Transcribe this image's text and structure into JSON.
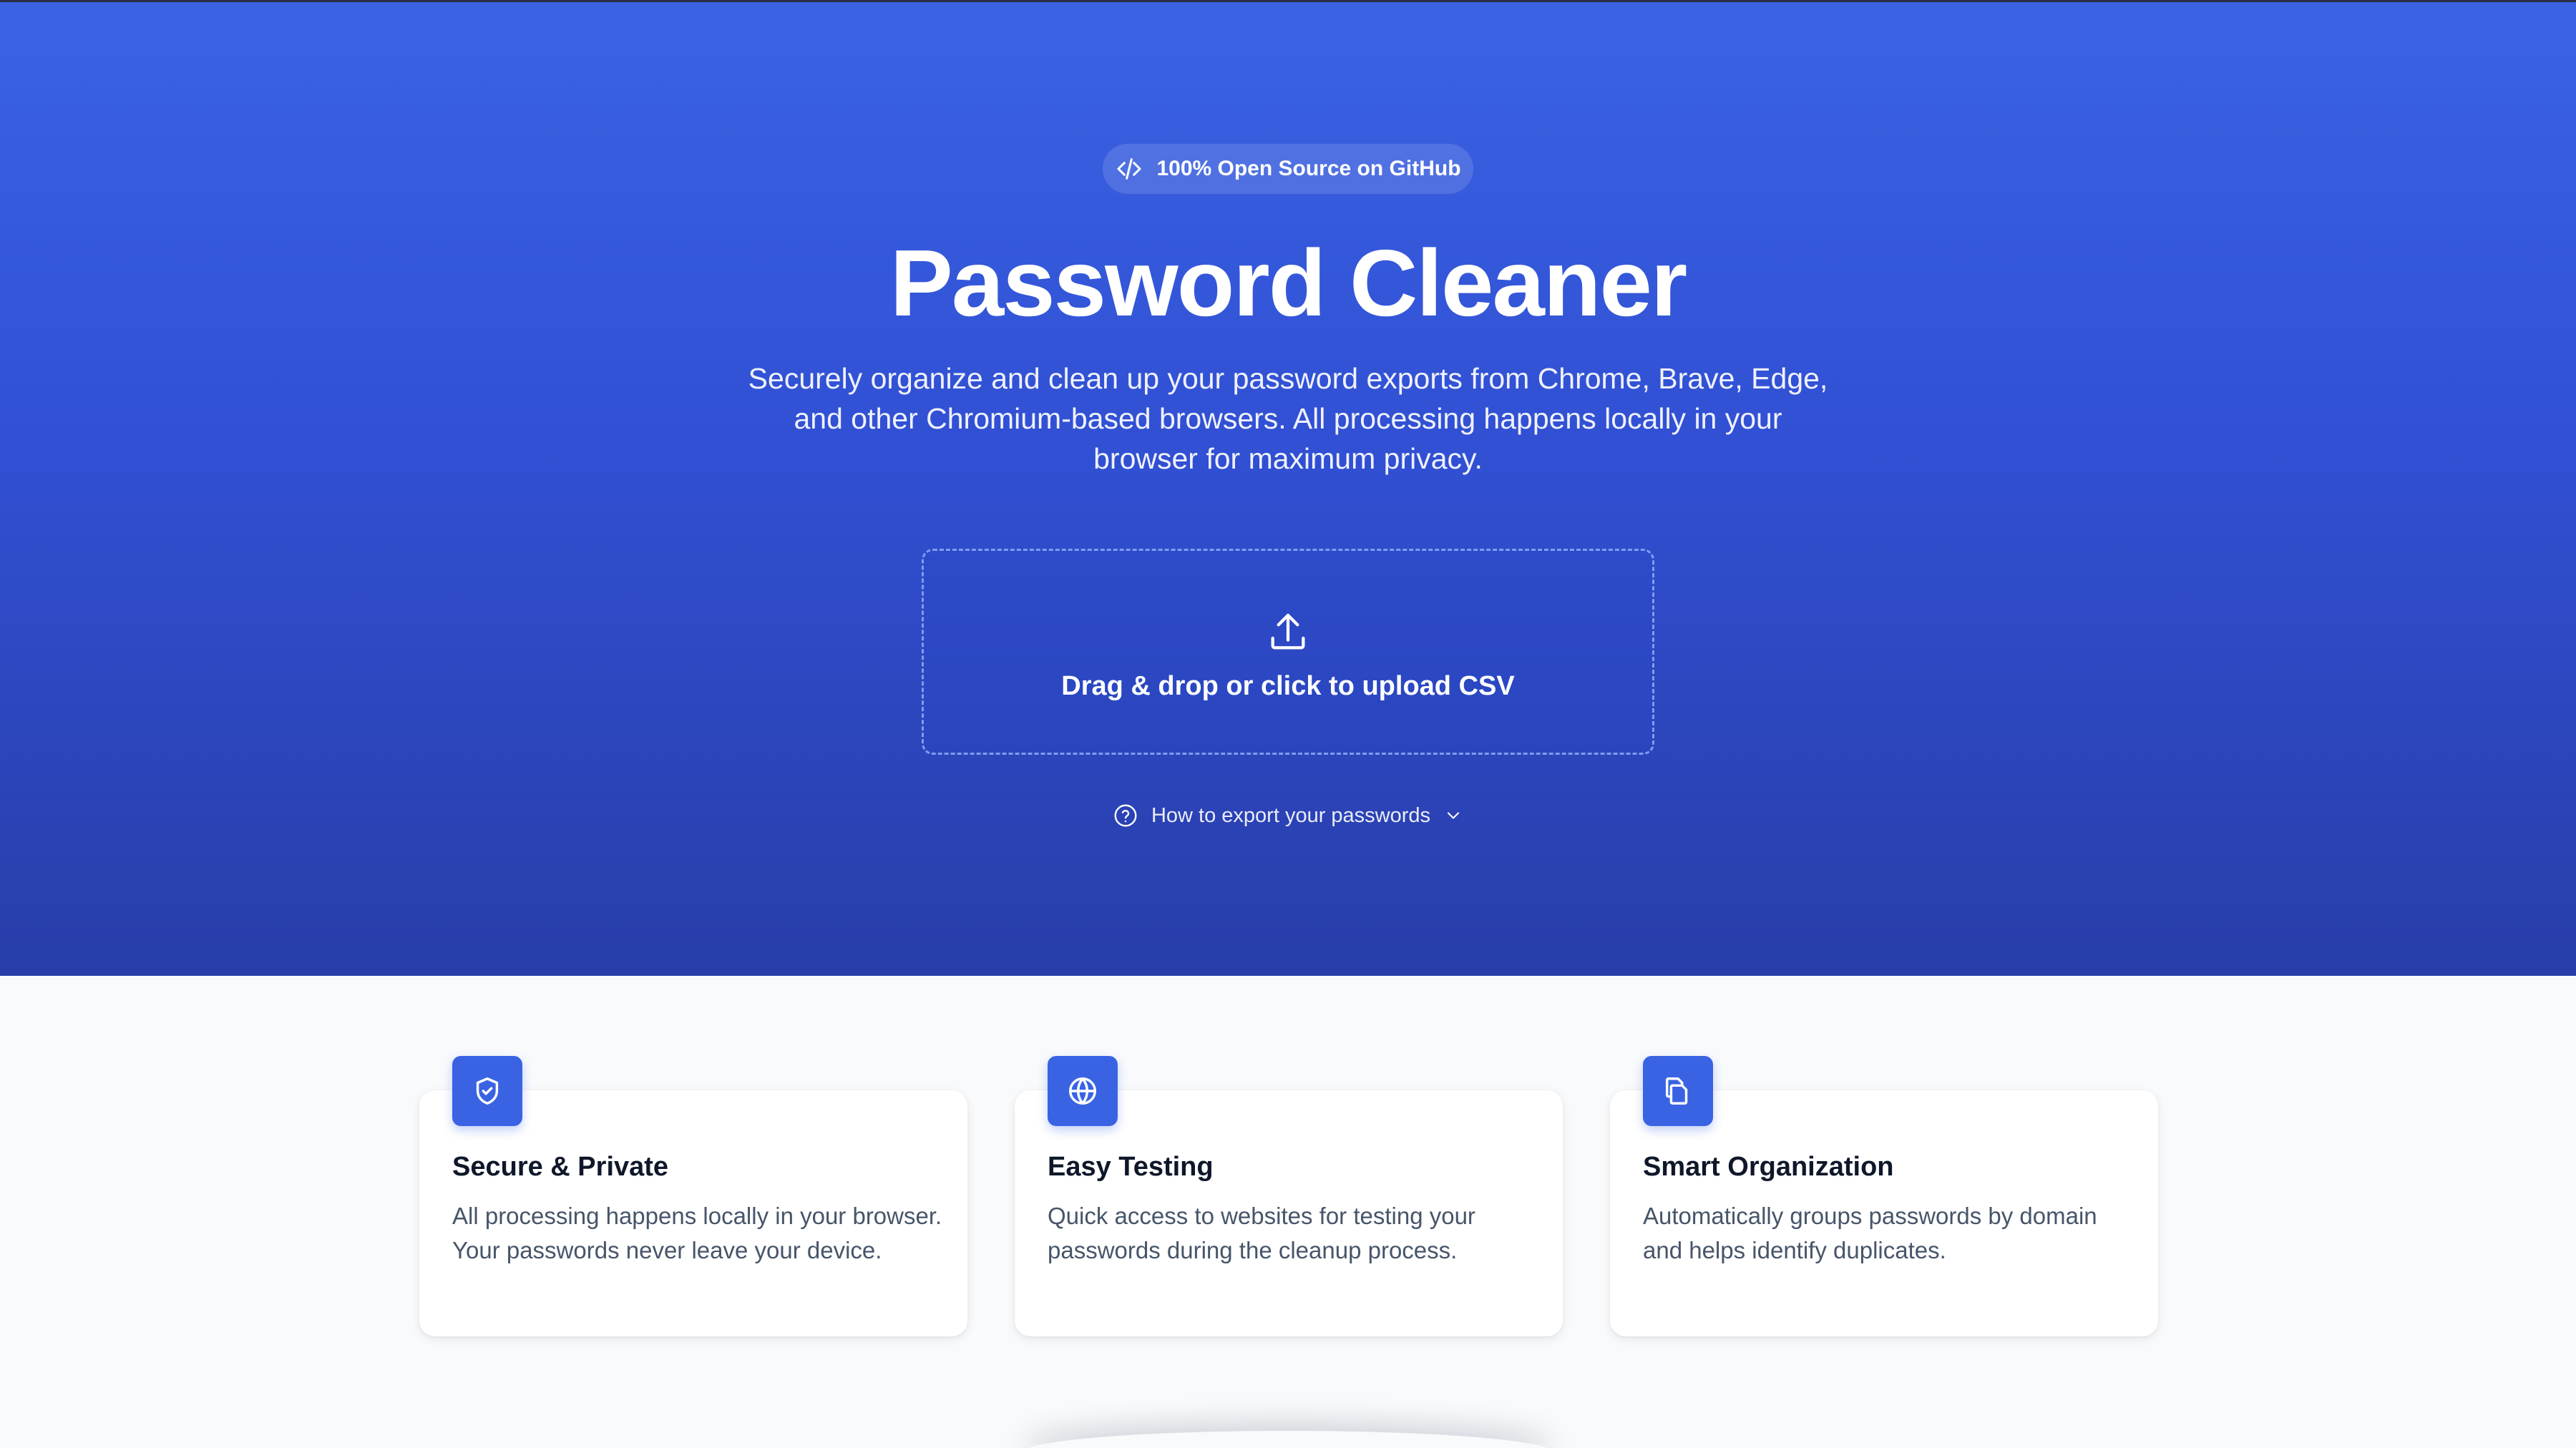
{
  "hero": {
    "badge_label": "100% Open Source on GitHub",
    "title": "Password Cleaner",
    "subtitle": "Securely organize and clean up your password exports from Chrome, Brave, Edge, and other Chromium-based browsers. All processing happens locally in your browser for maximum privacy.",
    "upload_label": "Drag & drop or click to upload CSV",
    "howto_label": "How to export your passwords"
  },
  "features": [
    {
      "icon": "shield-check-icon",
      "title": "Secure & Private",
      "description": "All processing happens locally in your browser. Your passwords never leave your device."
    },
    {
      "icon": "globe-icon",
      "title": "Easy Testing",
      "description": "Quick access to websites for testing your passwords during the cleanup process."
    },
    {
      "icon": "copy-icon",
      "title": "Smart Organization",
      "description": "Automatically groups passwords by domain and helps identify duplicates."
    }
  ],
  "colors": {
    "hero_top": "#3a63e3",
    "hero_bottom": "#283da8",
    "accent": "#3a63e3",
    "page_bg": "#f8fafc"
  }
}
